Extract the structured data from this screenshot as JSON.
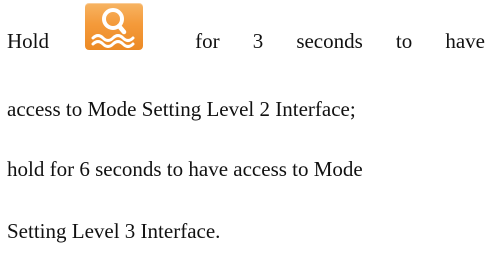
{
  "instruction": {
    "line1": {
      "word_hold": "Hold",
      "word_for": "for",
      "word_3": "3",
      "word_seconds": "seconds",
      "word_to": "to",
      "word_have": "have"
    },
    "line2": "access to Mode Setting Level 2 Interface;",
    "line3": "hold for 6 seconds to have access to Mode",
    "line4": "Setting Level 3 Interface."
  },
  "icon": {
    "name": "mode-search-wave-icon",
    "background_color": "#f49a3a",
    "glyph_color": "#ffffff"
  }
}
